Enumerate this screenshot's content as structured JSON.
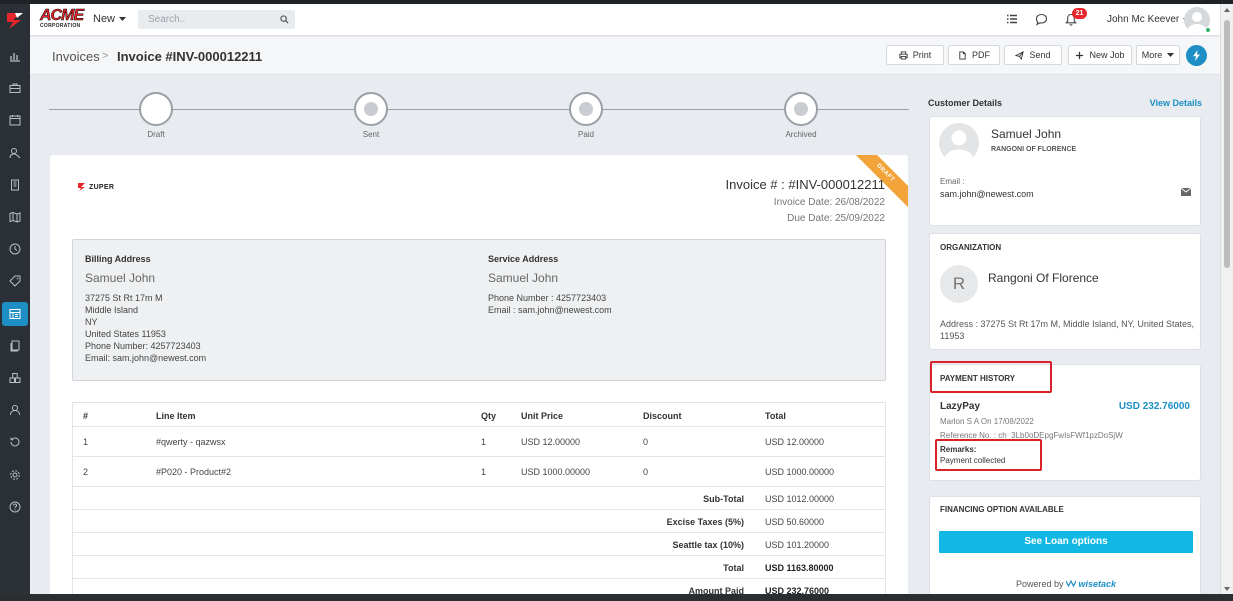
{
  "app": {
    "logo_text": "ACME",
    "logo_sub": "CORPORATION",
    "new_label": "New",
    "search_placeholder": "Search..",
    "notification_count": "21",
    "user_name": "John Mc Keever"
  },
  "breadcrumb": {
    "parent": "Invoices",
    "separator": ">",
    "current": "Invoice #INV-000012211"
  },
  "toolbar": {
    "print": "Print",
    "pdf": "PDF",
    "send": "Send",
    "new_job": "New Job",
    "more": "More"
  },
  "steps": [
    {
      "label": "Draft",
      "done": true
    },
    {
      "label": "Sent",
      "done": false
    },
    {
      "label": "Paid",
      "done": false
    },
    {
      "label": "Archived",
      "done": false
    }
  ],
  "invoice": {
    "brand": "ZUPER",
    "ribbon": "DRAFT",
    "number": "Invoice # : #INV-000012211",
    "invoice_date": "Invoice Date: 26/08/2022",
    "due_date": "Due Date: 25/09/2022",
    "billing": {
      "heading": "Billing Address",
      "name": "Samuel John",
      "lines": [
        "37275 St Rt 17m M",
        "Middle Island",
        "NY",
        "United States 11953",
        "Phone Number: 4257723403",
        "Email: sam.john@newest.com"
      ]
    },
    "service": {
      "heading": "Service Address",
      "name": "Samuel John",
      "lines": [
        "Phone Number : 4257723403",
        "Email : sam.john@newest.com"
      ]
    },
    "columns": [
      "#",
      "Line Item",
      "Qty",
      "Unit Price",
      "Discount",
      "Total"
    ],
    "items": [
      {
        "no": "1",
        "item": "#qwerty - qazwsx",
        "qty": "1",
        "unit_price": "USD 12.00000",
        "discount": "0",
        "total": "USD 12.00000"
      },
      {
        "no": "2",
        "item": "#P020 - Product#2",
        "qty": "1",
        "unit_price": "USD 1000.00000",
        "discount": "0",
        "total": "USD 1000.00000"
      }
    ],
    "totals": [
      {
        "label": "Sub-Total",
        "value": "USD 1012.00000",
        "bold": false
      },
      {
        "label": "Excise Taxes (5%)",
        "value": "USD 50.60000",
        "bold": false
      },
      {
        "label": "Seattle tax (10%)",
        "value": "USD 101.20000",
        "bold": false
      },
      {
        "label": "Total",
        "value": "USD 1163.80000",
        "bold": true
      },
      {
        "label": "Amount Paid",
        "value": "USD 232.76000",
        "bold": true
      }
    ]
  },
  "customer": {
    "section_title": "Customer Details",
    "view_details": "View Details",
    "name": "Samuel John",
    "org": "RANGONI OF FLORENCE",
    "email_label": "Email :",
    "email": "sam.john@newest.com"
  },
  "organization": {
    "heading": "ORGANIZATION",
    "initial": "R",
    "name": "Rangoni Of Florence",
    "address": "Address : 37275 St Rt 17m M, Middle Island, NY, United States, 11953"
  },
  "payment": {
    "heading": "PAYMENT HISTORY",
    "method": "LazyPay",
    "amount": "USD 232.76000",
    "by": "Marlon S A On 17/08/2022",
    "reference": "Reference No. : ch_3Lb0oDEpgFwIsFWf1pzDoSjW",
    "remarks_label": "Remarks:",
    "remarks": "Payment collected"
  },
  "financing": {
    "heading": "FINANCING OPTION AVAILABLE",
    "button": "See Loan options",
    "powered_by": "Powered by",
    "partner": "wisetack"
  },
  "colors": {
    "accent": "#1d8fc4",
    "success": "#27b46b",
    "danger": "#d8232a",
    "loan_button": "#12b8e4",
    "ribbon": "#f2a33a"
  }
}
